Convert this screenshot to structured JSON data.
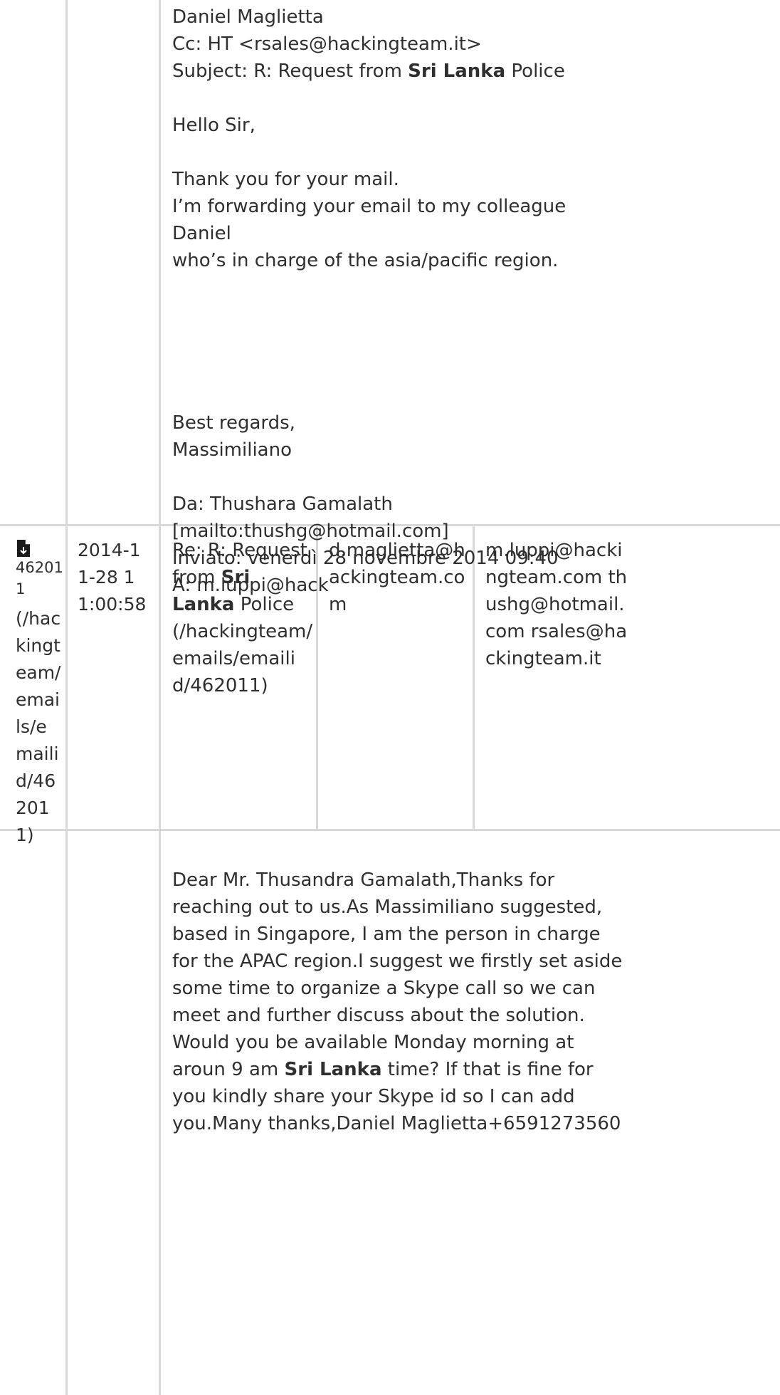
{
  "row1": {
    "body_lines": [
      "Daniel Maglietta",
      "Cc: HT <rsales@hackingteam.it>",
      "Subject: R: Request from ",
      "Sri Lanka",
      " Police",
      "Hello Sir,",
      "Thank you for your mail.",
      "I’m forwarding your email to my colleague Daniel",
      "who’s in charge of the asia/pacific region.",
      "Best regards,",
      "Massimiliano",
      "Da: Thushara Gamalath",
      "[mailto:thushg@hotmail.com]",
      "Inviato: venerdì 28 novembre 2014 09:40",
      "A: m.luppi@hack"
    ]
  },
  "row2": {
    "id_number": "462011",
    "id_link": "(/hackingteam/emails/emailid/462011)",
    "date": "2014-11-28 11:00:58",
    "subject_pre": "Re: R: Request from ",
    "subject_bold": "Sri Lanka",
    "subject_post": " Police",
    "subject_link": "(/hackingteam/emails/emailid/462011)",
    "from": "d.maglietta@hackingteam.com",
    "to": "m.luppi@hackingteam.com thushg@hotmail.com rsales@hackingteam.it"
  },
  "row3": {
    "body_pre": "Dear Mr. Thusandra Gamalath,Thanks for reaching out to us.As Massimiliano suggested, based in Singapore, I am the person in charge for the APAC region.I suggest we firstly set aside some time to organize a Skype call so we can meet and further discuss about the solution. Would you be available Monday morning at aroun 9 am ",
    "body_bold": "Sri Lanka",
    "body_post": " time? If that is fine for you kindly share your Skype id so I can add you.Many thanks,Daniel Maglietta+6591273560"
  },
  "colors": {
    "text": "#2f2f2f",
    "grid": "#d9d9d9"
  },
  "icons": {
    "file": "file-download-icon"
  }
}
